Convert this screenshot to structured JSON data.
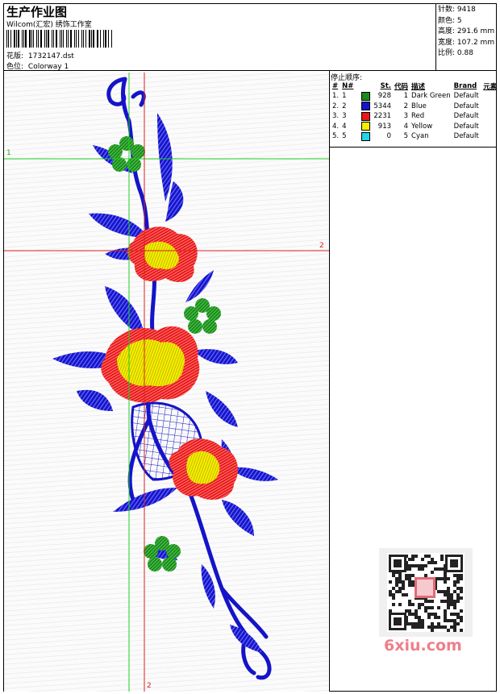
{
  "header": {
    "title": "生产作业图",
    "company": "Wilcom(汇宏) 绣饰工作室",
    "pattern_label": "花版:",
    "pattern_value": "1732147.dst",
    "color_label": "色位:",
    "color_value": "Colorway 1"
  },
  "stats": {
    "stitches_label": "针数:",
    "stitches_value": "9418",
    "colors_label": "颜色:",
    "colors_value": "5",
    "height_label": "高度:",
    "height_value": "291.6 mm",
    "width_label": "宽度:",
    "width_value": "107.2 mm",
    "scale_label": "比例:",
    "scale_value": "0.88"
  },
  "stop_sequence": {
    "title": "停止顺序:",
    "columns": [
      "#",
      "N#",
      "St.",
      "代码",
      "描述",
      "Brand",
      "元素"
    ],
    "rows": [
      {
        "idx": "1.",
        "n": "1",
        "color": "#1a8a1a",
        "st": "928",
        "code": "1",
        "desc": "Dark Green",
        "brand": "Default"
      },
      {
        "idx": "2.",
        "n": "2",
        "color": "#1414c8",
        "st": "5344",
        "code": "2",
        "desc": "Blue",
        "brand": "Default"
      },
      {
        "idx": "3.",
        "n": "3",
        "color": "#e81818",
        "st": "2231",
        "code": "3",
        "desc": "Red",
        "brand": "Default"
      },
      {
        "idx": "4.",
        "n": "4",
        "color": "#f5f000",
        "st": "913",
        "code": "4",
        "desc": "Yellow",
        "brand": "Default"
      },
      {
        "idx": "5.",
        "n": "5",
        "color": "#22d6e6",
        "st": "0",
        "code": "5",
        "desc": "Cyan",
        "brand": "Default"
      }
    ]
  },
  "guides": {
    "h1": "1",
    "h2": "2",
    "v2": "2"
  },
  "colors": {
    "green": "#1a8a1a",
    "blue": "#1414c8",
    "red": "#e81818",
    "yellow": "#f5f000",
    "guide_green": "#22cc22",
    "guide_red": "#dd2020"
  },
  "watermark": "6xiu.com"
}
